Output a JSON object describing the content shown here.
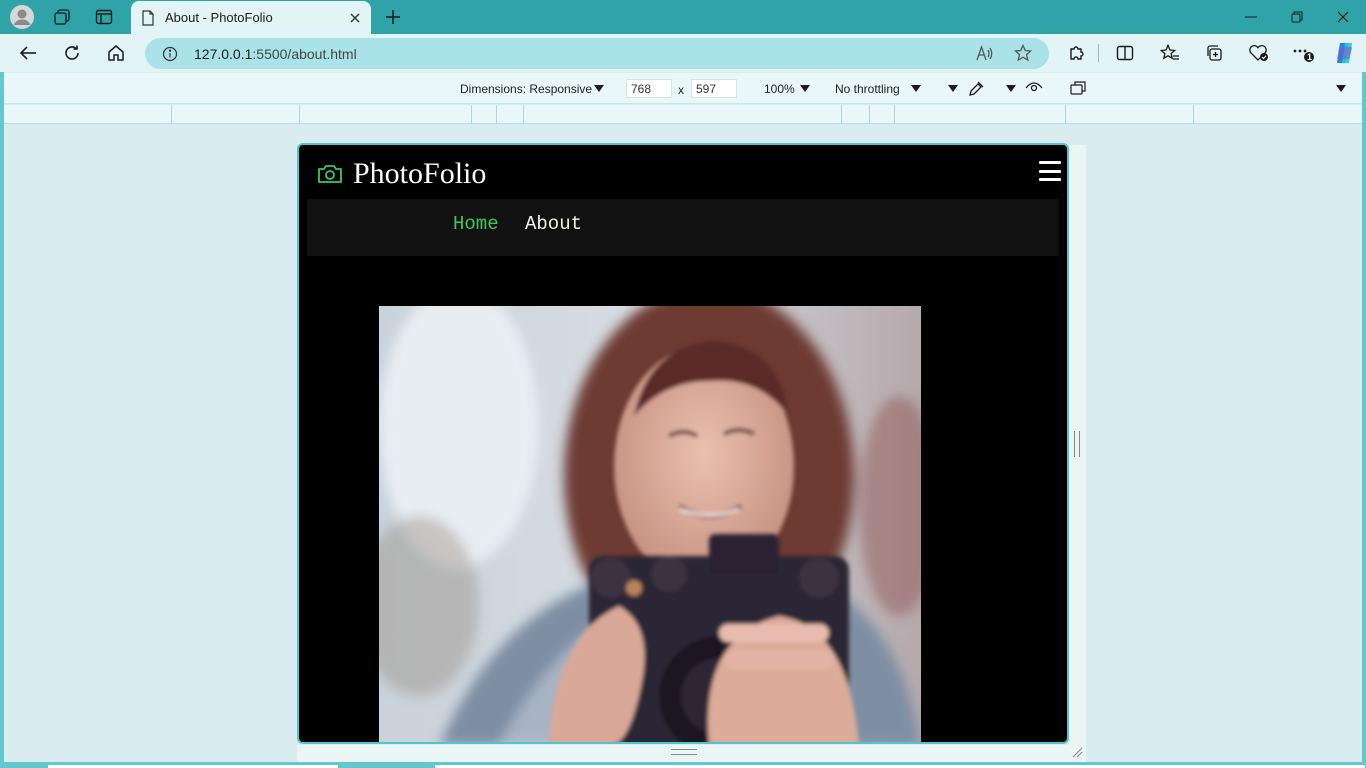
{
  "browser": {
    "tab": {
      "title": "About - PhotoFolio"
    },
    "address": {
      "url_host": "127.0.0.1",
      "url_rest": ":5500/about.html"
    },
    "window_controls": [
      "minimize",
      "restore",
      "close"
    ],
    "extensions_badge": "1"
  },
  "devtools": {
    "dimensions_label": "Dimensions: Responsive",
    "width": "768",
    "times": "x",
    "height": "597",
    "zoom": "100%",
    "throttling": "No throttling"
  },
  "site": {
    "brand": "PhotoFolio",
    "nav": {
      "home": "Home",
      "about": "About"
    },
    "colors": {
      "accent": "#3ec95a",
      "nav_bg": "#111111",
      "page_bg": "#000000"
    },
    "hero_image": "woman-holding-camera-photo"
  }
}
